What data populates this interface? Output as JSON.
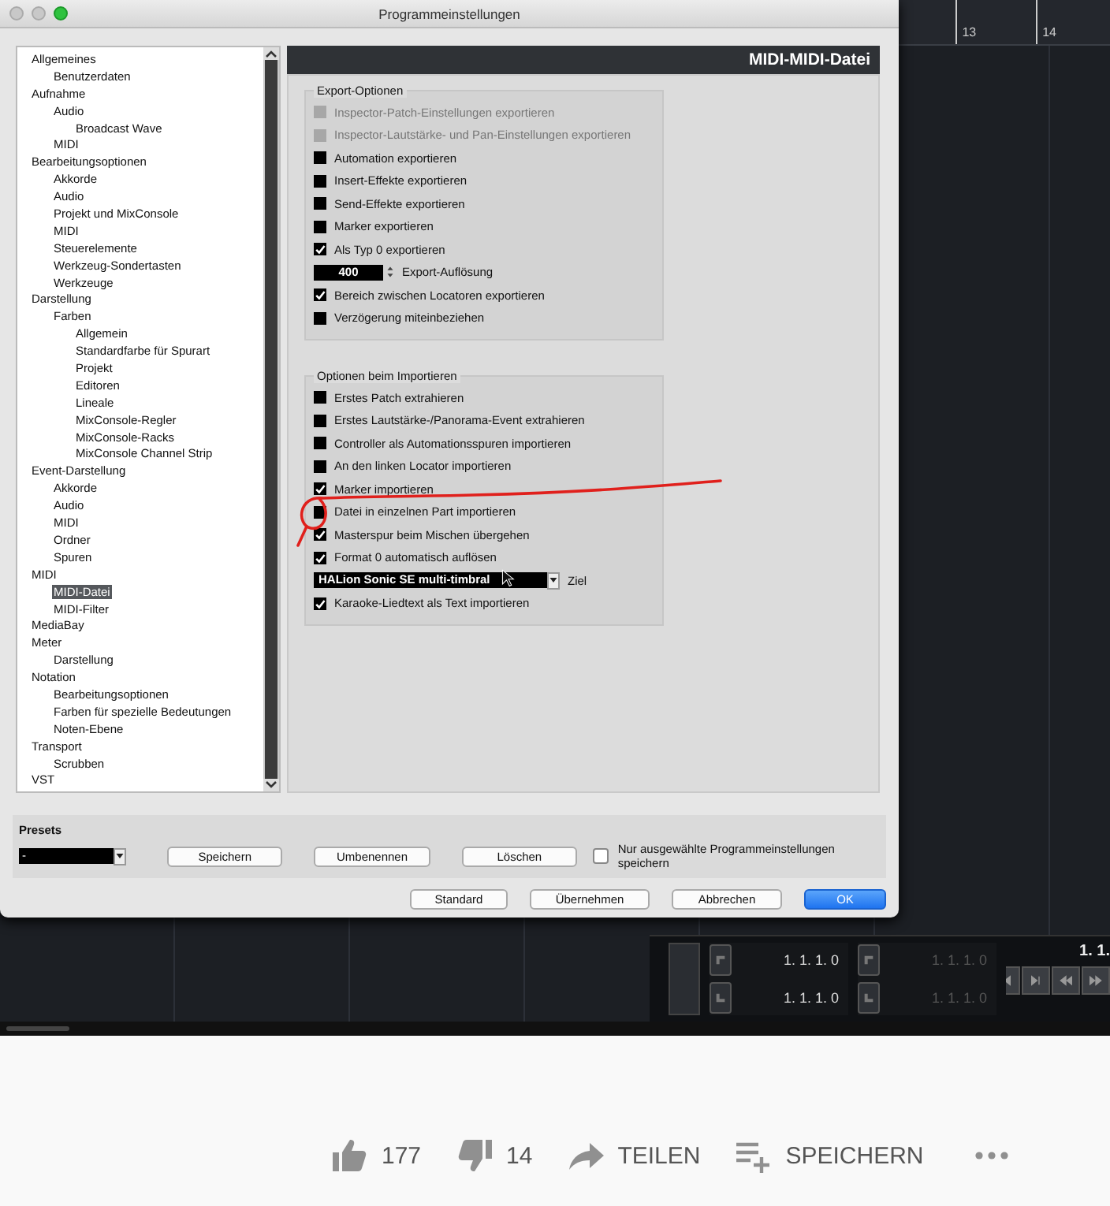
{
  "video": {
    "ruler": [
      "13",
      "14"
    ],
    "dialog": {
      "title": "Programmeinstellungen",
      "sidebar": {
        "items": [
          {
            "label": "Allgemeines",
            "selected": false,
            "children": [
              {
                "label": "Benutzerdaten",
                "selected": false
              }
            ]
          },
          {
            "label": "Aufnahme",
            "selected": false,
            "children": [
              {
                "label": "Audio",
                "selected": false,
                "children": [
                  {
                    "label": "Broadcast Wave",
                    "selected": false
                  }
                ]
              },
              {
                "label": "MIDI",
                "selected": false
              }
            ]
          },
          {
            "label": "Bearbeitungsoptionen",
            "selected": false,
            "children": [
              {
                "label": "Akkorde",
                "selected": false
              },
              {
                "label": "Audio",
                "selected": false
              },
              {
                "label": "Projekt und MixConsole",
                "selected": false
              },
              {
                "label": "MIDI",
                "selected": false
              },
              {
                "label": "Steuerelemente",
                "selected": false
              },
              {
                "label": "Werkzeug-Sondertasten",
                "selected": false
              },
              {
                "label": "Werkzeuge",
                "selected": false
              }
            ]
          },
          {
            "label": "Darstellung",
            "selected": false,
            "children": [
              {
                "label": "Farben",
                "selected": false,
                "children": [
                  {
                    "label": "Allgemein",
                    "selected": false
                  },
                  {
                    "label": "Standardfarbe für Spurart",
                    "selected": false
                  },
                  {
                    "label": "Projekt",
                    "selected": false
                  },
                  {
                    "label": "Editoren",
                    "selected": false
                  },
                  {
                    "label": "Lineale",
                    "selected": false
                  },
                  {
                    "label": "MixConsole-Regler",
                    "selected": false
                  },
                  {
                    "label": "MixConsole-Racks",
                    "selected": false
                  },
                  {
                    "label": "MixConsole Channel Strip",
                    "selected": false
                  }
                ]
              }
            ]
          },
          {
            "label": "Event-Darstellung",
            "selected": false,
            "children": [
              {
                "label": "Akkorde",
                "selected": false
              },
              {
                "label": "Audio",
                "selected": false
              },
              {
                "label": "MIDI",
                "selected": false
              },
              {
                "label": "Ordner",
                "selected": false
              },
              {
                "label": "Spuren",
                "selected": false
              }
            ]
          },
          {
            "label": "MIDI",
            "selected": false,
            "children": [
              {
                "label": "MIDI-Datei",
                "selected": true
              },
              {
                "label": "MIDI-Filter",
                "selected": false
              }
            ]
          },
          {
            "label": "MediaBay",
            "selected": false
          },
          {
            "label": "Meter",
            "selected": false,
            "children": [
              {
                "label": "Darstellung",
                "selected": false
              }
            ]
          },
          {
            "label": "Notation",
            "selected": false,
            "children": [
              {
                "label": "Bearbeitungsoptionen",
                "selected": false
              },
              {
                "label": "Farben für spezielle Bedeutungen",
                "selected": false
              },
              {
                "label": "Noten-Ebene",
                "selected": false
              }
            ]
          },
          {
            "label": "Transport",
            "selected": false,
            "children": [
              {
                "label": "Scrubben",
                "selected": false
              }
            ]
          },
          {
            "label": "VST",
            "selected": false
          }
        ]
      },
      "page_title": "MIDI-MIDI-Datei",
      "groups": [
        {
          "title": "Export-Optionen",
          "rows": [
            {
              "kind": "checkbox",
              "label": "Inspector-Patch-Einstellungen exportieren",
              "checked": false,
              "disabled": true
            },
            {
              "kind": "checkbox",
              "label": "Inspector-Lautstärke- und Pan-Einstellungen exportieren",
              "checked": false,
              "disabled": true
            },
            {
              "kind": "checkbox",
              "label": "Automation exportieren",
              "checked": false,
              "disabled": false
            },
            {
              "kind": "checkbox",
              "label": "Insert-Effekte exportieren",
              "checked": false,
              "disabled": false
            },
            {
              "kind": "checkbox",
              "label": "Send-Effekte exportieren",
              "checked": false,
              "disabled": false
            },
            {
              "kind": "checkbox",
              "label": "Marker exportieren",
              "checked": false,
              "disabled": false
            },
            {
              "kind": "checkbox",
              "label": "Als Typ 0 exportieren",
              "checked": true,
              "disabled": false
            },
            {
              "kind": "number",
              "entry": "400",
              "caption": "Export-Auflösung"
            },
            {
              "kind": "checkbox",
              "label": "Bereich zwischen Locatoren exportieren",
              "checked": true,
              "disabled": false
            },
            {
              "kind": "checkbox",
              "label": "Verzögerung miteinbeziehen",
              "checked": false,
              "disabled": false
            }
          ]
        },
        {
          "title": "Optionen beim Importieren",
          "rows": [
            {
              "kind": "checkbox",
              "label": "Erstes Patch extrahieren",
              "checked": false,
              "disabled": false
            },
            {
              "kind": "checkbox",
              "label": "Erstes Lautstärke-/Panorama-Event extrahieren",
              "checked": false,
              "disabled": false
            },
            {
              "kind": "checkbox",
              "label": "Controller als Automationsspuren importieren",
              "checked": false,
              "disabled": false
            },
            {
              "kind": "checkbox",
              "label": "An den linken Locator importieren",
              "checked": false,
              "disabled": false
            },
            {
              "kind": "checkbox",
              "label": "Marker importieren",
              "checked": true,
              "disabled": false
            },
            {
              "kind": "checkbox",
              "label": "Datei in einzelnen Part importieren",
              "checked": false,
              "disabled": false
            },
            {
              "kind": "checkbox",
              "label": "Masterspur beim Mischen übergehen",
              "checked": true,
              "disabled": false
            },
            {
              "kind": "checkbox",
              "label": "Format 0 automatisch auflösen",
              "checked": true,
              "disabled": false
            },
            {
              "kind": "dropdown",
              "entry": "HALion Sonic SE multi-timbral",
              "caption": "Ziel"
            },
            {
              "kind": "checkbox",
              "label": "Karaoke-Liedtext als Text importieren",
              "checked": true,
              "disabled": false
            }
          ]
        }
      ],
      "presets": {
        "label": "Presets",
        "value": "-",
        "buttons": [
          "Speichern",
          "Umbenennen",
          "Löschen"
        ],
        "option": {
          "label": "Nur ausgewählte Programmeinstellungen speichern",
          "checked": false
        }
      },
      "buttons": [
        {
          "label": "Standard",
          "default": false
        },
        {
          "label": "Übernehmen",
          "default": false
        },
        {
          "label": "Abbrechen",
          "default": false
        },
        {
          "label": "OK",
          "default": true
        }
      ]
    },
    "transport": {
      "fields": [
        {
          "text": "1. 1. 1. 0",
          "dimmed": false
        },
        {
          "text": "1. 1. 1. 0",
          "dimmed": true
        },
        {
          "text": "1. 1. 1. 0",
          "dimmed": false
        },
        {
          "text": "1. 1. 1. 0",
          "dimmed": true
        }
      ],
      "position": "1. 1."
    }
  },
  "actions": [
    {
      "kind": "like",
      "label": "177"
    },
    {
      "kind": "dislike",
      "label": "14"
    },
    {
      "kind": "share",
      "label": "TEILEN"
    },
    {
      "kind": "save",
      "label": "SPEICHERN"
    },
    {
      "kind": "more"
    }
  ]
}
